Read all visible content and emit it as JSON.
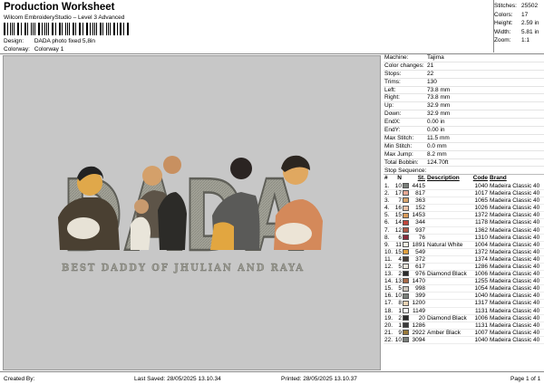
{
  "header": {
    "title": "Production Worksheet",
    "subtitle": "Wilcom EmbroideryStudio – Level 3 Advanced",
    "design_label": "Design:",
    "design_value": "DADA photo fixed 5,8in",
    "colorway_label": "Colorway:",
    "colorway_value": "Colorway 1"
  },
  "summary": [
    {
      "k": "Stitches:",
      "v": "25502"
    },
    {
      "k": "Colors:",
      "v": "17"
    },
    {
      "k": "Height:",
      "v": "2.59 in"
    },
    {
      "k": "Width:",
      "v": "5.81 in"
    },
    {
      "k": "Zoom:",
      "v": "1:1"
    }
  ],
  "design": {
    "letters": "DADA",
    "tagline": "BEST DADDY OF JHULIAN AND RAYA"
  },
  "machine_info": [
    {
      "k": "Machine:",
      "v": "Tajima"
    },
    {
      "k": "Color changes:",
      "v": "21"
    },
    {
      "k": "Stops:",
      "v": "22"
    },
    {
      "k": "Trims:",
      "v": "130"
    },
    {
      "k": "Left:",
      "v": "73.8 mm"
    },
    {
      "k": "Right:",
      "v": "73.8 mm"
    },
    {
      "k": "Up:",
      "v": "32.9 mm"
    },
    {
      "k": "Down:",
      "v": "32.9 mm"
    },
    {
      "k": "EndX:",
      "v": "0.00 in"
    },
    {
      "k": "EndY:",
      "v": "0.00 in"
    },
    {
      "k": "Max Stitch:",
      "v": "11.5 mm"
    },
    {
      "k": "Min Stitch:",
      "v": "0.0 mm"
    },
    {
      "k": "Max Jump:",
      "v": "8.2 mm"
    },
    {
      "k": "Total Bobbin:",
      "v": "124.70ft"
    }
  ],
  "stop_sequence": {
    "title": "Stop Sequence:",
    "headers": {
      "idx": "#",
      "num": "N",
      "st": "St.",
      "desc": "Description",
      "code": "Code",
      "brand": "Brand"
    },
    "rows": [
      {
        "idx": "1.",
        "num": "10",
        "color": "#7a7f7a",
        "st": "4415",
        "desc": "",
        "code": "1040",
        "brand": "Madeira Classic 40"
      },
      {
        "idx": "2.",
        "num": "17",
        "color": "#e8a894",
        "st": "817",
        "desc": "",
        "code": "1017",
        "brand": "Madeira Classic 40"
      },
      {
        "idx": "3.",
        "num": "7",
        "color": "#d9a46a",
        "st": "363",
        "desc": "",
        "code": "1065",
        "brand": "Madeira Classic 40"
      },
      {
        "idx": "4.",
        "num": "16",
        "color": "#e9c2a8",
        "st": "152",
        "desc": "",
        "code": "1026",
        "brand": "Madeira Classic 40"
      },
      {
        "idx": "5.",
        "num": "15",
        "color": "#d89a5a",
        "st": "1453",
        "desc": "",
        "code": "1372",
        "brand": "Madeira Classic 40"
      },
      {
        "idx": "6.",
        "num": "14",
        "color": "#c0463c",
        "st": "344",
        "desc": "",
        "code": "1178",
        "brand": "Madeira Classic 40"
      },
      {
        "idx": "7.",
        "num": "12",
        "color": "#b05a48",
        "st": "937",
        "desc": "",
        "code": "1362",
        "brand": "Madeira Classic 40"
      },
      {
        "idx": "8.",
        "num": "6",
        "color": "#8a2a3a",
        "st": "76",
        "desc": "",
        "code": "1310",
        "brand": "Madeira Classic 40"
      },
      {
        "idx": "9.",
        "num": "11",
        "color": "#f4efe2",
        "st": "1891",
        "desc": "Natural White",
        "code": "1004",
        "brand": "Madeira Classic 40"
      },
      {
        "idx": "10.",
        "num": "15",
        "color": "#e0a040",
        "st": "549",
        "desc": "",
        "code": "1372",
        "brand": "Madeira Classic 40"
      },
      {
        "idx": "11.",
        "num": "4",
        "color": "#4a4038",
        "st": "372",
        "desc": "",
        "code": "1374",
        "brand": "Madeira Classic 40"
      },
      {
        "idx": "12.",
        "num": "5",
        "color": "#eae6dc",
        "st": "617",
        "desc": "",
        "code": "1286",
        "brand": "Madeira Classic 40"
      },
      {
        "idx": "13.",
        "num": "2",
        "color": "#2a2a2a",
        "st": "976",
        "desc": "Diamond Black",
        "code": "1006",
        "brand": "Madeira Classic 40"
      },
      {
        "idx": "14.",
        "num": "13",
        "color": "#a86a48",
        "st": "1470",
        "desc": "",
        "code": "1255",
        "brand": "Madeira Classic 40"
      },
      {
        "idx": "15.",
        "num": "5",
        "color": "#cfc8bd",
        "st": "998",
        "desc": "",
        "code": "1054",
        "brand": "Madeira Classic 40"
      },
      {
        "idx": "16.",
        "num": "10",
        "color": "#7a7f7a",
        "st": "399",
        "desc": "",
        "code": "1040",
        "brand": "Madeira Classic 40"
      },
      {
        "idx": "17.",
        "num": "8",
        "color": "#e9d3b4",
        "st": "1200",
        "desc": "",
        "code": "1317",
        "brand": "Madeira Classic 40"
      },
      {
        "idx": "18.",
        "num": "1",
        "color": "#ffffff",
        "st": "1149",
        "desc": "",
        "code": "1131",
        "brand": "Madeira Classic 40"
      },
      {
        "idx": "19.",
        "num": "2",
        "color": "#2a2a2a",
        "st": "20",
        "desc": "Diamond Black",
        "code": "1006",
        "brand": "Madeira Classic 40"
      },
      {
        "idx": "20.",
        "num": "1",
        "color": "#3a3a3a",
        "st": "1286",
        "desc": "",
        "code": "1131",
        "brand": "Madeira Classic 40"
      },
      {
        "idx": "21.",
        "num": "9",
        "color": "#9a7a3a",
        "st": "2922",
        "desc": "Amber Black",
        "code": "1007",
        "brand": "Madeira Classic 40"
      },
      {
        "idx": "22.",
        "num": "10",
        "color": "#7a7f7a",
        "st": "3094",
        "desc": "",
        "code": "1040",
        "brand": "Madeira Classic 40"
      }
    ]
  },
  "footer": {
    "created_by": "Created By:",
    "last_saved": "Last Saved: 28/05/2025 13.10.34",
    "printed": "Printed: 28/05/2025 13.10.37",
    "page": "Page 1 of 1"
  }
}
